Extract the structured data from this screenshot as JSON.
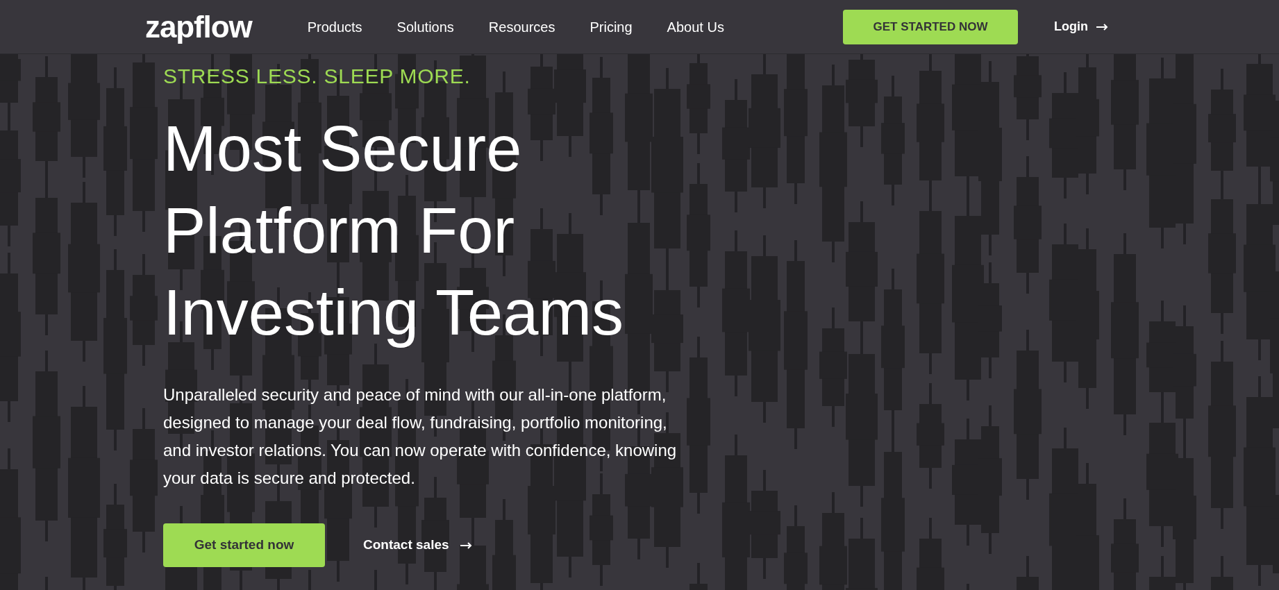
{
  "header": {
    "logo": "zapflow",
    "nav": [
      "Products",
      "Solutions",
      "Resources",
      "Pricing",
      "About Us"
    ],
    "cta": "GET STARTED NOW",
    "login": "Login"
  },
  "hero": {
    "tagline": "STRESS LESS. SLEEP MORE.",
    "headline": [
      "Most Secure",
      "Platform For",
      "Investing Teams"
    ],
    "description": "Unparalleled security and peace of mind with our all-in-one platform, designed to manage your deal flow, fundraising, portfolio monitoring, and investor relations. You can now operate with confidence, knowing your data is secure and protected.",
    "primary_button": "Get started now",
    "secondary_link": "Contact sales"
  }
}
